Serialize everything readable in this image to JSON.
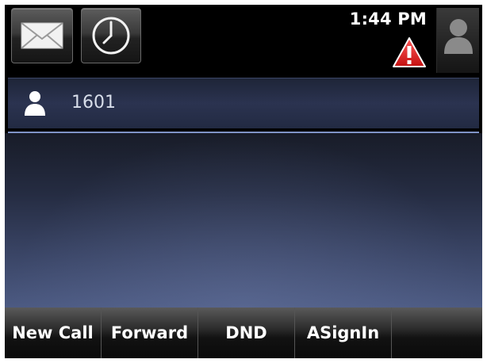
{
  "status_bar": {
    "time": "1:44 PM",
    "messages_icon": "envelope-icon",
    "history_icon": "clock-icon",
    "alert_icon": "warning-triangle-icon",
    "avatar_icon": "user-silhouette-icon"
  },
  "line": {
    "icon": "user-icon",
    "label": "1601"
  },
  "softkeys": [
    {
      "label": "New Call"
    },
    {
      "label": "Forward"
    },
    {
      "label": "DND"
    },
    {
      "label": "ASignIn"
    },
    {
      "label": ""
    }
  ],
  "colors": {
    "alert": "#e01e1e",
    "line_divider": "#7f93c6",
    "text": "#ffffff"
  }
}
